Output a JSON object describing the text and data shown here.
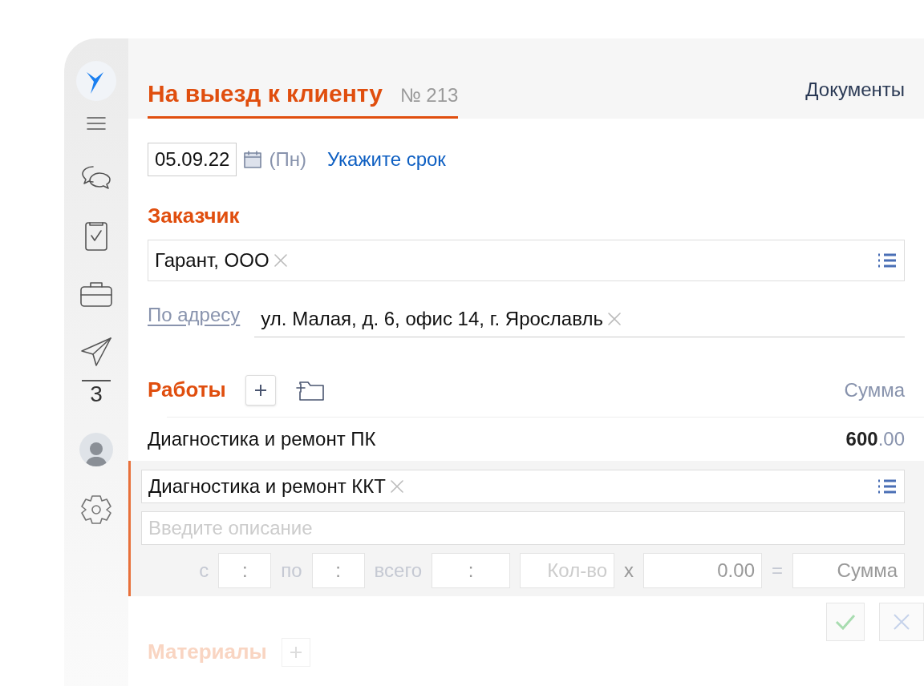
{
  "sidebar": {
    "counter": "3"
  },
  "tabs": [
    {
      "label": "На выезд к клиенту",
      "number": "№ 213",
      "selected": true
    },
    {
      "label": "Документы",
      "selected": false
    }
  ],
  "date": {
    "value": "05.09.22",
    "weekday": "(Пн)",
    "deadline_link": "Укажите срок"
  },
  "customer": {
    "heading": "Заказчик",
    "value": "Гарант, ООО"
  },
  "address": {
    "link": "По адресу",
    "value": "ул. Малая, д. 6, офис 14, г. Ярославль"
  },
  "works": {
    "heading": "Работы",
    "sum_heading": "Сумма",
    "rows": [
      {
        "name": "Диагностика и ремонт ПК",
        "amount": "**600**.00"
      }
    ],
    "editor": {
      "value": "Диагностика и ремонт ККТ",
      "description_placeholder": "Введите описание",
      "from_label": "с",
      "from_value": ":",
      "to_label": "по",
      "to_value": ":",
      "total_label": "всего",
      "total_value": ":",
      "qty_placeholder": "Кол-во",
      "times": "x",
      "price_value": "0.00",
      "equals": "=",
      "sum_placeholder": "Сумма"
    }
  },
  "materials": {
    "heading": "Материалы"
  }
}
